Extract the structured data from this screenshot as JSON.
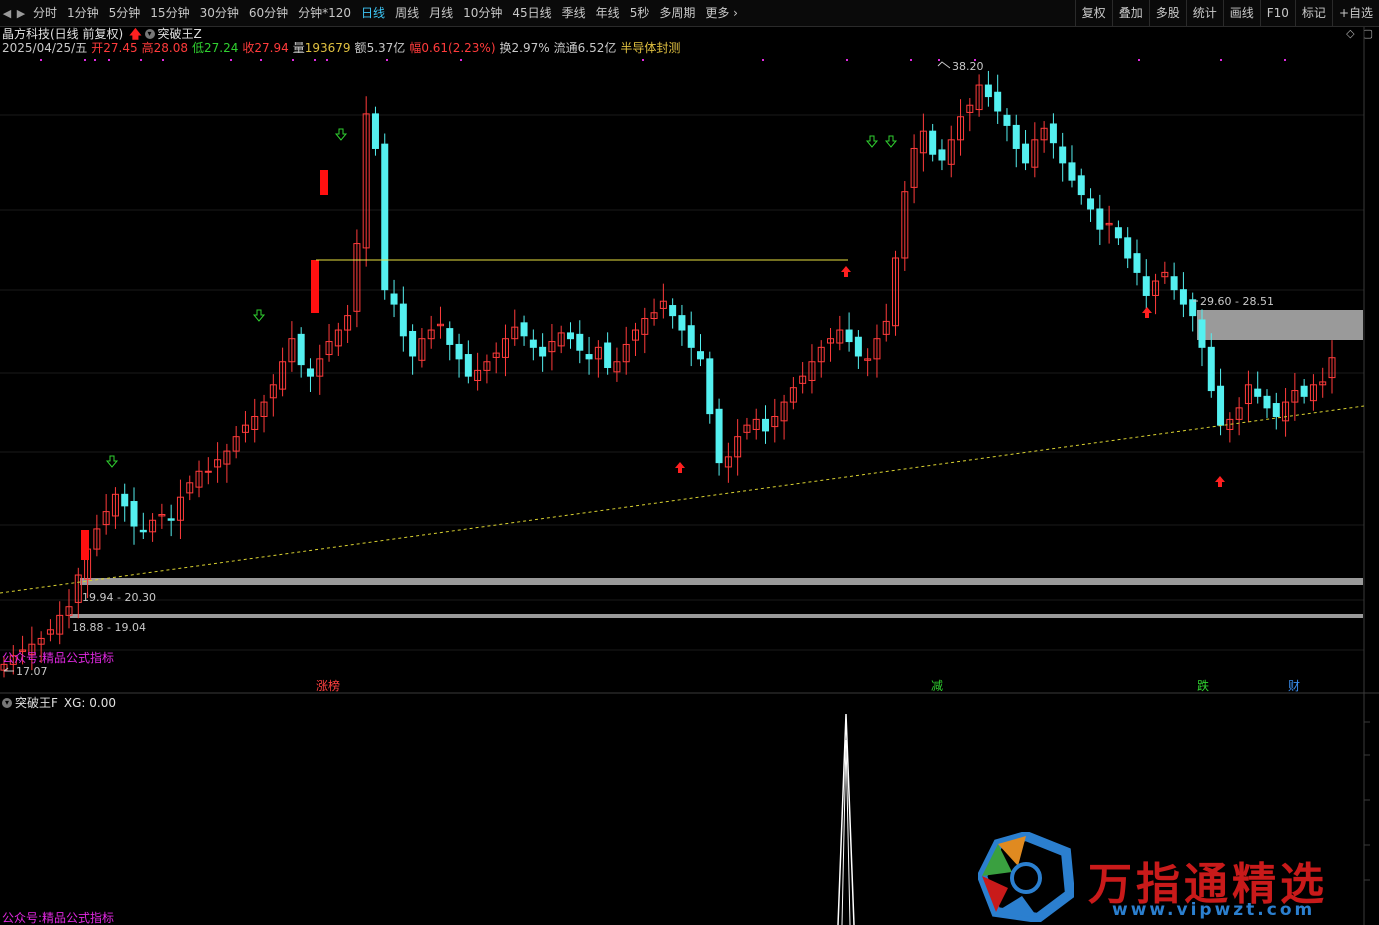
{
  "toolbar": {
    "tabs": [
      "分时",
      "1分钟",
      "5分钟",
      "15分钟",
      "30分钟",
      "60分钟",
      "分钟*120",
      "日线",
      "周线",
      "月线",
      "10分钟",
      "45日线",
      "季线",
      "年线",
      "5秒",
      "多周期",
      "更多"
    ],
    "active_tab": "日线",
    "right_buttons": [
      "复权",
      "叠加",
      "多股",
      "统计",
      "画线",
      "F10",
      "标记",
      "+自选"
    ]
  },
  "header": {
    "stock_title": "晶方科技(日线 前复权)",
    "indicator_name": "突破王Z",
    "date": "2025/04/25/五",
    "open_label": "开",
    "open_value": "27.45",
    "high_label": "高",
    "high_value": "28.08",
    "low_label": "低",
    "low_value": "27.24",
    "close_label": "收",
    "close_value": "27.94",
    "volume_label": "量",
    "volume_value": "193679",
    "amount_label": "额",
    "amount_value": "5.37亿",
    "change_label": "幅",
    "change_value": "0.61(2.23%)",
    "turnover_label": "换",
    "turnover_value": "2.97%",
    "float_label": "流通",
    "float_value": "6.52亿",
    "sector": "半导体封测"
  },
  "main_chart": {
    "price_labels": {
      "high_mark": "38.20",
      "low_mark": "17.07",
      "zone_top_right": "29.60 - 28.51",
      "zone_left_1": "19.94 - 20.30",
      "zone_left_2": "18.88 - 19.04"
    },
    "bottom_markers": [
      {
        "text": "涨榜",
        "color": "#ff4040"
      },
      {
        "text": "减",
        "color": "#30d030"
      },
      {
        "text": "跌",
        "color": "#30d030"
      },
      {
        "text": "财",
        "color": "#3a8ef0"
      }
    ],
    "watermark_text": "公众号:精品公式指标",
    "colors": {
      "up": "#ff3b3b",
      "down": "#54f0f0",
      "background": "#000000",
      "grid": "#1e1e1e",
      "breakout_line": "#e8e040",
      "trend_line": "#d8d030",
      "zone": "#9a9a9a"
    }
  },
  "sub_chart": {
    "indicator_name": "突破王F",
    "value_label": "XG: 0.00",
    "watermark_text": "公众号:精品公式指标"
  },
  "brand_watermark": {
    "name": "万指通精选",
    "url": "www.vipwzt.com"
  }
}
